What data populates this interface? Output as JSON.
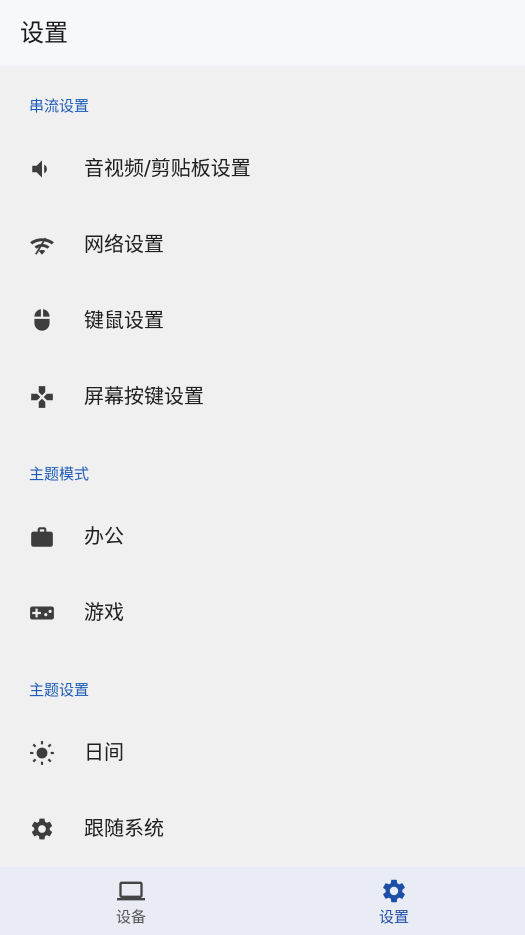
{
  "header": {
    "title": "设置"
  },
  "sections": [
    {
      "title": "串流设置",
      "items": [
        {
          "label": "音视频/剪贴板设置",
          "icon": "volume-icon"
        },
        {
          "label": "网络设置",
          "icon": "wifi-icon"
        },
        {
          "label": "键鼠设置",
          "icon": "mouse-icon"
        },
        {
          "label": "屏幕按键设置",
          "icon": "gamepad-icon"
        }
      ]
    },
    {
      "title": "主题模式",
      "items": [
        {
          "label": "办公",
          "icon": "briefcase-icon"
        },
        {
          "label": "游戏",
          "icon": "game-controller-icon"
        }
      ]
    },
    {
      "title": "主题设置",
      "items": [
        {
          "label": "日间",
          "icon": "sun-icon"
        },
        {
          "label": "跟随系统",
          "icon": "gear-icon"
        }
      ]
    }
  ],
  "bottom_nav": {
    "items": [
      {
        "label": "设备",
        "icon": "laptop-icon",
        "active": false
      },
      {
        "label": "设置",
        "icon": "settings-icon",
        "active": true
      }
    ]
  },
  "colors": {
    "accent": "#1e4fa8",
    "section_header": "#1e5bb8",
    "background": "#f0f0f0"
  }
}
